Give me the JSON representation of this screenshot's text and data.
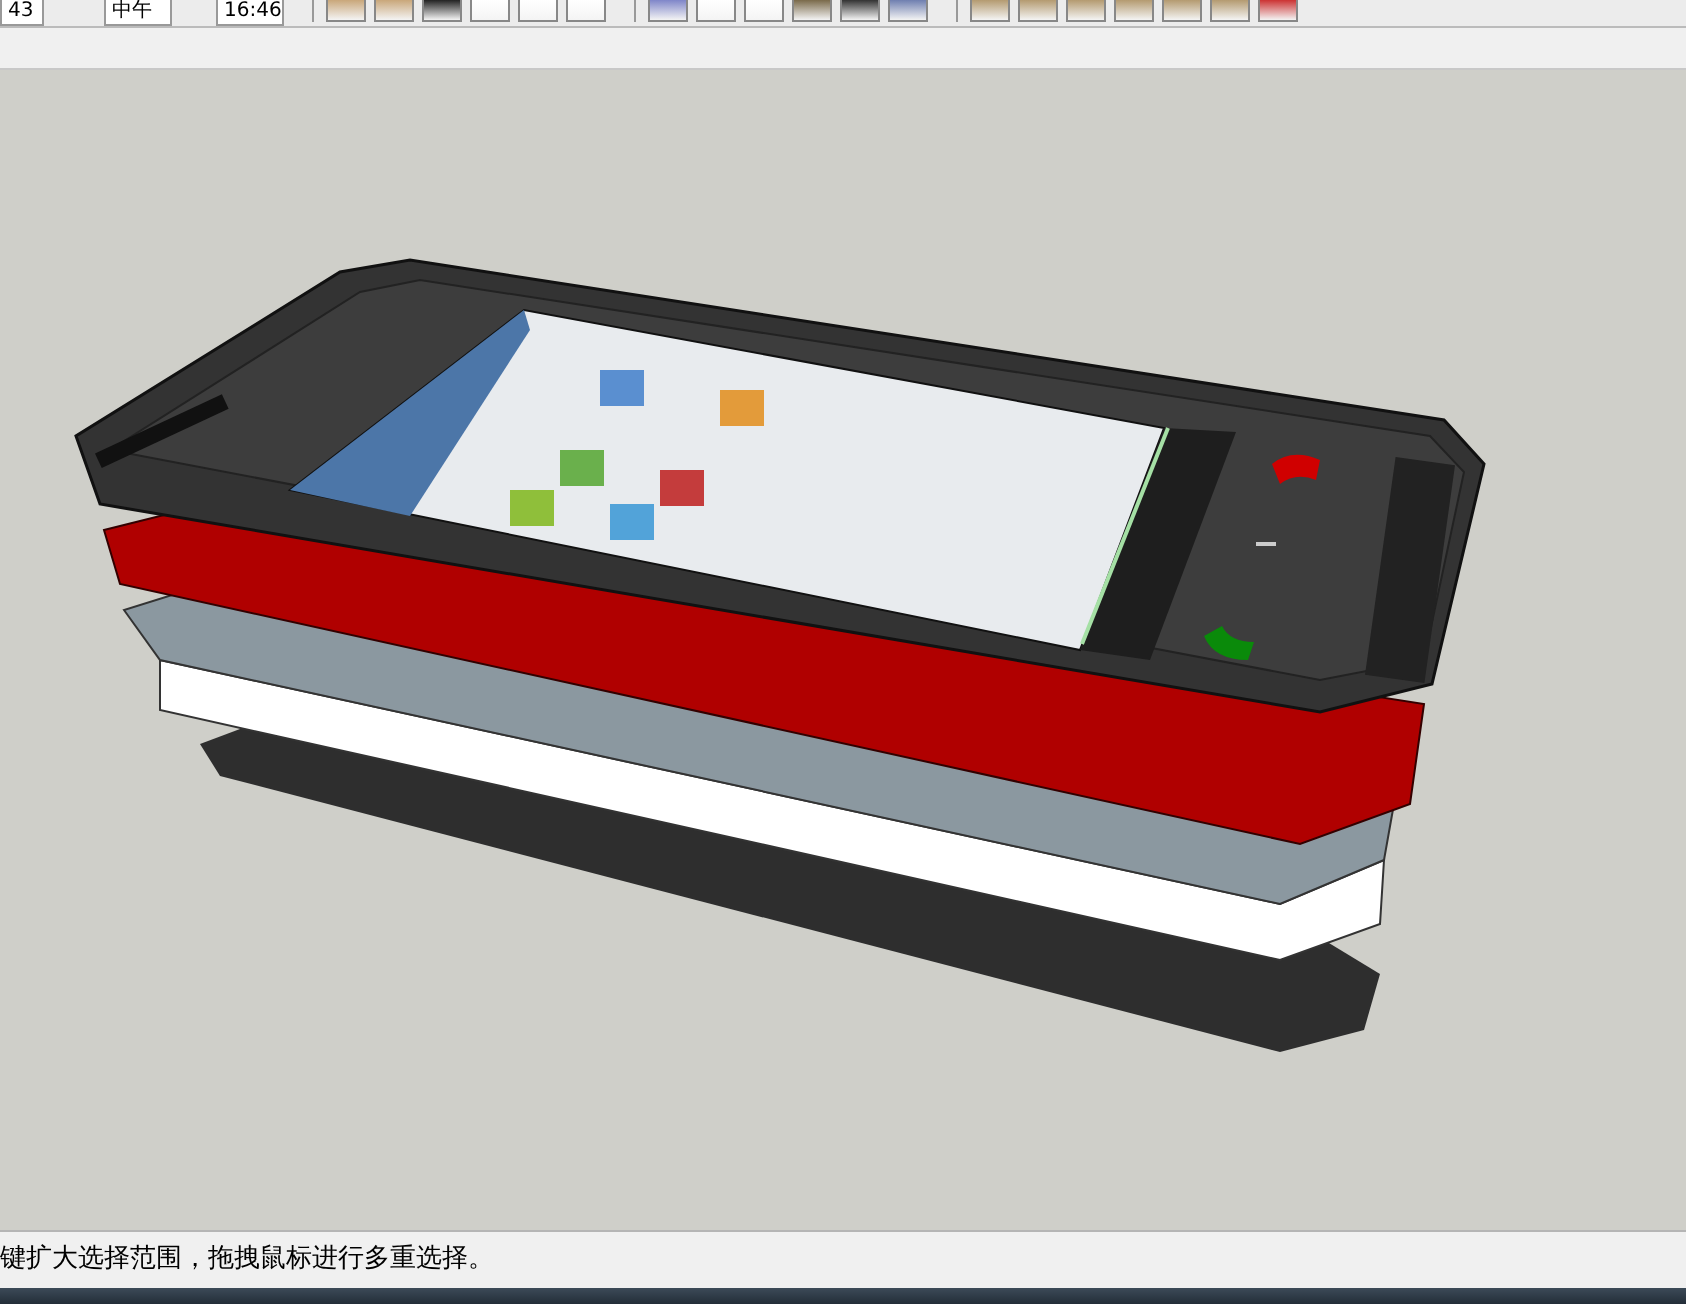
{
  "toolbar": {
    "fields": [
      "43",
      "中午",
      "16:46"
    ]
  },
  "status_bar": {
    "text": "键扩大选择范围，拖拽鼠标进行多重选择。"
  }
}
